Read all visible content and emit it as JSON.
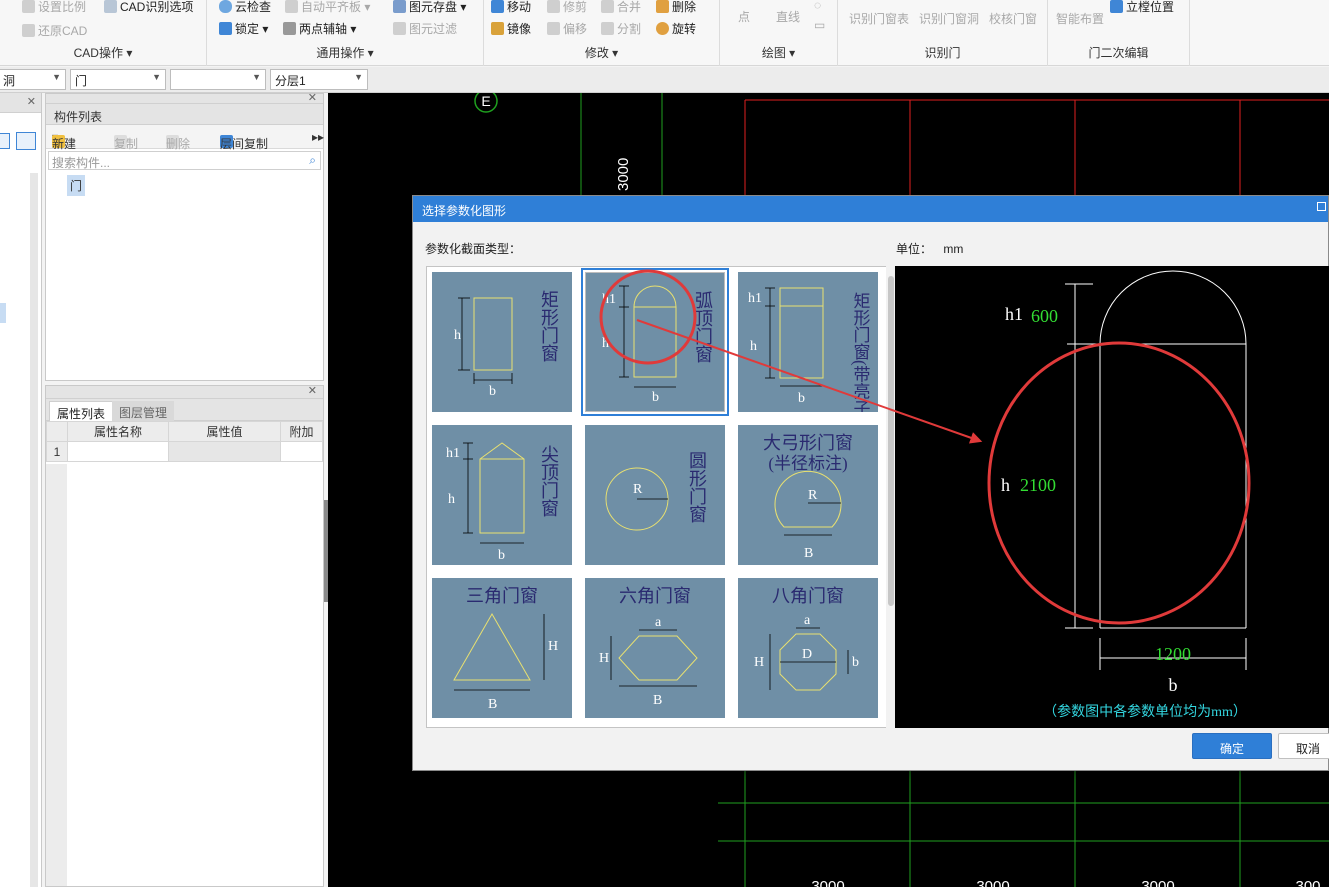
{
  "ribbon": {
    "cad": {
      "title": "CAD操作",
      "items": [
        "设置比例",
        "CAD识别选项",
        "还原CAD"
      ]
    },
    "general": {
      "title": "通用操作",
      "items": [
        "云检查",
        "自动平齐板",
        "图元存盘",
        "锁定",
        "两点辅轴",
        "图元过滤"
      ]
    },
    "modify": {
      "title": "修改",
      "items": [
        "移动",
        "修剪",
        "合并",
        "删除",
        "镜像",
        "偏移",
        "分割",
        "旋转"
      ]
    },
    "draw": {
      "title": "绘图",
      "items": [
        "点",
        "直线"
      ]
    },
    "recognize": {
      "title": "识别门",
      "items": [
        "识别门窗表",
        "识别门窗洞",
        "校核门窗"
      ]
    },
    "edit2": {
      "title": "门二次编辑",
      "items": [
        "智能布置",
        "立樘位置"
      ]
    }
  },
  "selectors": {
    "s1": "洞",
    "s2": "门",
    "s3": "",
    "s4": "分层1"
  },
  "component_panel": {
    "title": "构件列表",
    "tools": [
      "新建",
      "复制",
      "删除",
      "层间复制"
    ],
    "search_placeholder": "搜索构件...",
    "tree_item": "门"
  },
  "property_panel": {
    "tabs": [
      "属性列表",
      "图层管理"
    ],
    "columns": [
      "属性名称",
      "属性值",
      "附加"
    ],
    "rows": [
      {
        "index": "1",
        "name": "",
        "value": "",
        "extra": ""
      }
    ]
  },
  "canvas": {
    "axis_label": "E",
    "vertical_dim": "3000",
    "bottom_dims": [
      "3000",
      "3000",
      "3000",
      "300"
    ]
  },
  "dialog": {
    "title": "选择参数化图形",
    "type_label": "参数化截面类型：",
    "unit_label": "单位：",
    "unit_value": "mm",
    "shapes": [
      {
        "name": "矩形门窗",
        "params": [
          "h",
          "b"
        ]
      },
      {
        "name": "弧顶门窗",
        "params": [
          "h1",
          "h",
          "b"
        ]
      },
      {
        "name": "矩形门窗(带亮子)",
        "params": [
          "h1",
          "h",
          "b"
        ]
      },
      {
        "name": "尖顶门窗",
        "params": [
          "h1",
          "h",
          "b"
        ]
      },
      {
        "name": "圆形门窗",
        "params": [
          "R"
        ]
      },
      {
        "name": "大弓形门窗",
        "subtitle": "(半径标注)",
        "params": [
          "R",
          "B"
        ]
      },
      {
        "name": "三角门窗",
        "params": [
          "H",
          "B"
        ]
      },
      {
        "name": "六角门窗",
        "params": [
          "a",
          "H",
          "B"
        ]
      },
      {
        "name": "八角门窗",
        "params": [
          "a",
          "D",
          "H",
          "b"
        ]
      }
    ],
    "selected_shape": "弧顶门窗",
    "preview": {
      "h1_label": "h1",
      "h1_value": "600",
      "h_label": "h",
      "h_value": "2100",
      "b_value": "1200",
      "b_label": "b",
      "note": "（参数图中各参数单位均为mm）"
    },
    "ok_label": "确定",
    "cancel_label": "取消"
  },
  "colors": {
    "accent": "#2f7fd7",
    "tile": "#6f8fa6",
    "tile_text": "#2a2a70",
    "shape_line": "#e8e070",
    "annotation": "#e03a3a",
    "param_value": "#33dd33",
    "note": "#33d6e0"
  }
}
